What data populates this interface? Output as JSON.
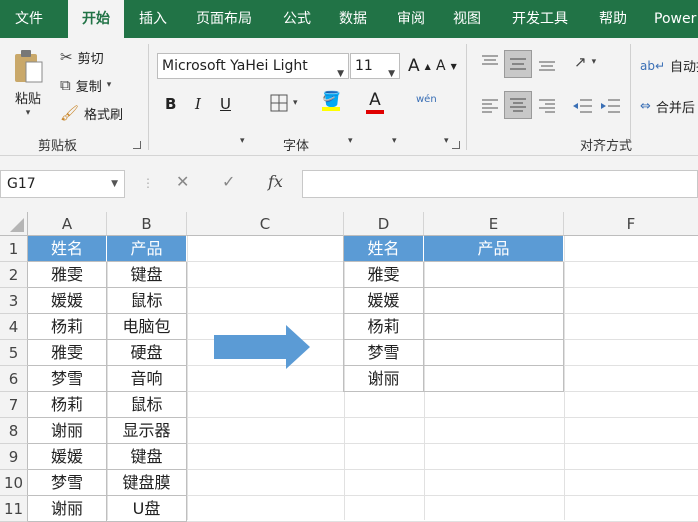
{
  "tabs": [
    "文件",
    "开始",
    "插入",
    "页面布局",
    "公式",
    "数据",
    "审阅",
    "视图",
    "开发工具",
    "帮助",
    "Power"
  ],
  "active_tab": "开始",
  "clipboard": {
    "paste": "粘贴",
    "cut": "剪切",
    "copy": "复制",
    "format_painter": "格式刷",
    "label": "剪贴板"
  },
  "font": {
    "name": "Microsoft YaHei Light",
    "size": "11",
    "grow": "A",
    "shrink": "A",
    "bold": "B",
    "italic": "I",
    "underline": "U",
    "font_color": "A",
    "phonetic": "wén",
    "label": "字体"
  },
  "alignment": {
    "wrap": "自动换",
    "merge": "合并后",
    "label": "对齐方式"
  },
  "namebox": "G17",
  "formula_bar": {
    "cancel": "✕",
    "enter": "✓",
    "fx": "fx"
  },
  "columns": [
    "A",
    "B",
    "C",
    "D",
    "E",
    "F"
  ],
  "rows": [
    "1",
    "2",
    "3",
    "4",
    "5",
    "6",
    "7",
    "8",
    "9",
    "10",
    "11"
  ],
  "left_table": {
    "headers": [
      "姓名",
      "产品"
    ],
    "rows": [
      [
        "雅雯",
        "键盘"
      ],
      [
        "媛媛",
        "鼠标"
      ],
      [
        "杨莉",
        "电脑包"
      ],
      [
        "雅雯",
        "硬盘"
      ],
      [
        "梦雪",
        "音响"
      ],
      [
        "杨莉",
        "鼠标"
      ],
      [
        "谢丽",
        "显示器"
      ],
      [
        "媛媛",
        "键盘"
      ],
      [
        "梦雪",
        "键盘膜"
      ],
      [
        "谢丽",
        "U盘"
      ]
    ]
  },
  "right_table": {
    "headers": [
      "姓名",
      "产品"
    ],
    "rows": [
      [
        "雅雯",
        ""
      ],
      [
        "媛媛",
        ""
      ],
      [
        "杨莉",
        ""
      ],
      [
        "梦雪",
        ""
      ],
      [
        "谢丽",
        ""
      ]
    ]
  },
  "colors": {
    "excel_green": "#217346",
    "header_blue": "#5b9bd5",
    "arrow_blue": "#5b9bd5"
  }
}
